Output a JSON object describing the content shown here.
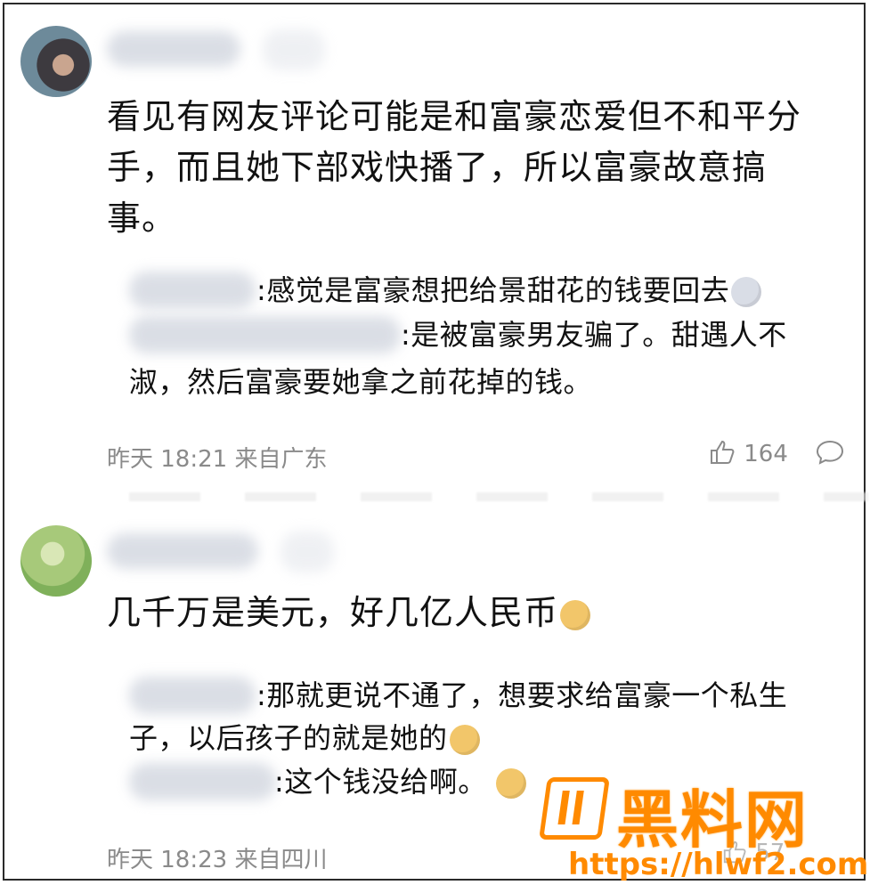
{
  "comments": [
    {
      "avatar_icon": "user-avatar-icon",
      "content": "看见有网友评论可能是和富豪恋爱但不和平分手，而且她下部戏快播了，所以富豪故意搞事。",
      "content_lines": [
        "看见有网友评论可能是和富豪恋爱但不和平分",
        "手，而且她下部戏快播了，所以富豪故意搞",
        "事。"
      ],
      "replies": [
        {
          "text": ":感觉是富豪想把给景甜花的钱要回去",
          "emoji": "husky-emoji-icon"
        },
        {
          "text_lines": [
            ":是被富豪男友骗了。甜遇人不",
            "淑，然后富豪要她拿之前花掉的钱。"
          ]
        }
      ],
      "meta": "昨天 18:21 来自广东",
      "likes": "164"
    },
    {
      "avatar_icon": "user-avatar-icon",
      "content": "几千万是美元，好几亿人民币",
      "emoji": "doge-emoji-icon",
      "replies": [
        {
          "text_lines": [
            ":那就更说不通了，想要求给富豪一个私生",
            "子，以后孩子的就是她的"
          ],
          "emoji": "doge-emoji-icon"
        },
        {
          "text": ":这个钱没给啊。",
          "emoji": "thinking-emoji-icon"
        }
      ],
      "meta": "昨天 18:23 来自四川",
      "likes": "57"
    }
  ],
  "watermark": {
    "title": "黑料网",
    "url": "https://hlwf2.com",
    "color": "#ff8a00"
  }
}
